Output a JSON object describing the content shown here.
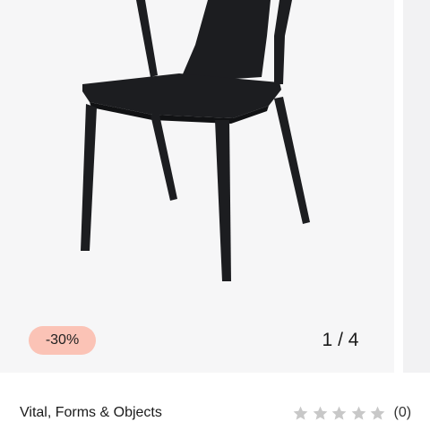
{
  "gallery": {
    "discount_badge": "-30%",
    "pager": {
      "current": "1",
      "separator": "/",
      "total": "4"
    },
    "image_alt": "black-chair-product-image"
  },
  "product": {
    "brand": "Vital, Forms & Objects",
    "rating_count": "(0)",
    "rating_value": 0,
    "rating_max": 5,
    "star_color": "#c8c8c8"
  },
  "colors": {
    "badge_bg": "#fbc3b6",
    "slide_bg": "#f6f6f7",
    "chair": "#1c1d20"
  }
}
